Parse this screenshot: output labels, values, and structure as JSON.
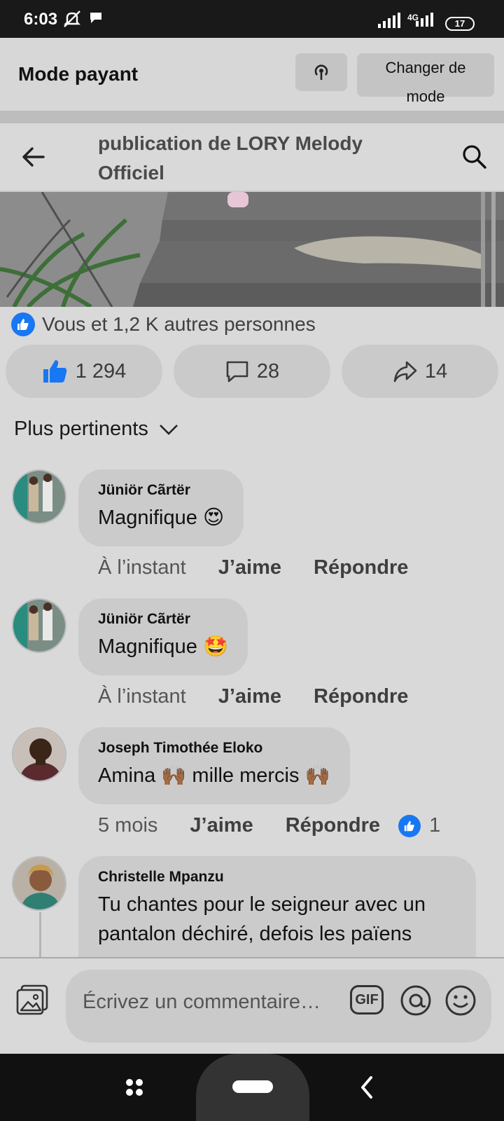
{
  "status_bar": {
    "time": "6:03",
    "network": "4G",
    "battery": "17"
  },
  "pay_bar": {
    "title": "Mode payant",
    "change_line1": "Changer de",
    "change_line2": "mode"
  },
  "nav": {
    "title_line1": "publication de LORY Melody",
    "title_line2": "Officiel"
  },
  "reactions": {
    "summary": "Vous et 1,2 K autres personnes"
  },
  "actions": {
    "likes": "1 294",
    "comments": "28",
    "shares": "14"
  },
  "sort": {
    "label": "Plus pertinents"
  },
  "comments": [
    {
      "author": "Jüniör Cãrtër",
      "text": "Magnifique",
      "emoji": "😍",
      "time": "À l’instant",
      "like_label": "J’aime",
      "reply_label": "Répondre"
    },
    {
      "author": "Jüniör Cãrtër",
      "text": "Magnifique",
      "emoji": "🤩",
      "time": "À l’instant",
      "like_label": "J’aime",
      "reply_label": "Répondre"
    },
    {
      "author": "Joseph Timothée Eloko",
      "text": "Amina 🙌🏾 mille mercis 🙌🏾",
      "time": "5 mois",
      "like_label": "J’aime",
      "reply_label": "Répondre",
      "reaction_count": "1"
    },
    {
      "author": "Christelle Mpanzu",
      "text_line1": "Tu chantes pour le seigneur avec un",
      "text_line2": "pantalon déchiré, defois les païens"
    }
  ],
  "composer": {
    "placeholder": "Écrivez un commentaire…",
    "gif_label": "GIF"
  },
  "colors": {
    "facebook_blue": "#1877f2",
    "bubble_gray": "#cbcbcb",
    "background": "#d9d9d9"
  }
}
